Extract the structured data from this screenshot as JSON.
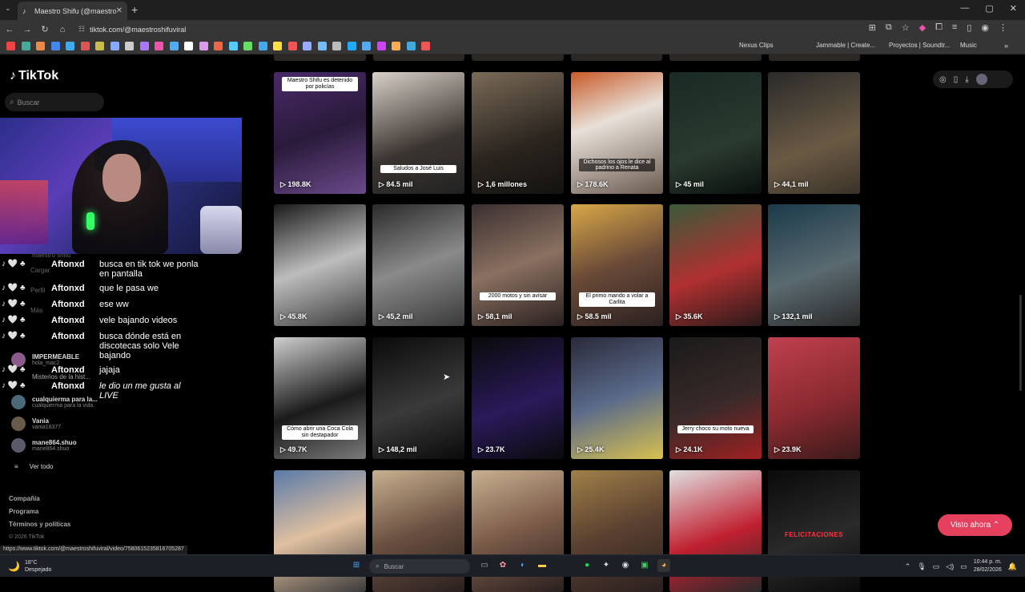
{
  "browser": {
    "tab_title": "Maestro Shifu (@maestroshifuvi...",
    "tab_close": "✕",
    "new_tab": "+",
    "url": "tiktok.com/@maestroshifuviral",
    "window_controls": [
      "—",
      "▢",
      "✕"
    ]
  },
  "bookmarks": {
    "nexus": "Nexus Clips",
    "jammable": "Jammable | Create...",
    "proyectos": "Proyectos | Soundtr...",
    "music": "Music",
    "colors": [
      "#e44",
      "#4a9",
      "#e84",
      "#48e",
      "#4ae",
      "#d55",
      "#cb4",
      "#8af",
      "#ccc",
      "#a7f",
      "#e5a",
      "#5ae",
      "#fff",
      "#d9e",
      "#e64",
      "#5cf",
      "#6d6",
      "#4ae",
      "#fd4",
      "#e55",
      "#9af",
      "#7bf",
      "#bbb",
      "#2af",
      "#5ae",
      "#c4f",
      "#fa5",
      "#4ad",
      "#e55"
    ]
  },
  "tiktok": {
    "logo": "TikTok",
    "search_placeholder": "Buscar",
    "accounts": [
      {
        "name": "IMPERMEABLE",
        "handle": "hola_mac2"
      },
      {
        "name": "cualquierma para la...",
        "handle": "cualquierma para la vida"
      },
      {
        "name": "Vania",
        "handle": "vania18377"
      },
      {
        "name": "mane864.shuo",
        "handle": "mane864.shuo"
      }
    ],
    "sidebar_bg": [
      "maestro shifu",
      "Cargar",
      "Perfil",
      "Más",
      "Misterios de la hist..."
    ],
    "see_all": "Ver todo",
    "footer": [
      "Compañía",
      "Programa",
      "Términos y políticas"
    ],
    "copyright": "© 2026 TikTok",
    "visto_ahora": "Visto ahora ⌃"
  },
  "chat": [
    {
      "user": "Aftonxd",
      "text": "busca en tik tok we ponla en pantalla",
      "italic": false
    },
    {
      "user": "Aftonxd",
      "text": "que le pasa we",
      "italic": false
    },
    {
      "user": "Aftonxd",
      "text": "ese ww",
      "italic": false
    },
    {
      "user": "Aftonxd",
      "text": "vele bajando videos",
      "italic": false
    },
    {
      "user": "Aftonxd",
      "text": "busca dónde está en discotecas solo Vele bajando",
      "italic": false
    },
    {
      "user": "Aftonxd",
      "text": "jajaja",
      "italic": false
    },
    {
      "user": "Aftonxd",
      "text": "le dio un me gusta al LIVE",
      "italic": true
    }
  ],
  "chat_badges": "♪ 🤍 ♣",
  "videos": [
    {
      "count": "198.8K",
      "caption": "Maestro Shifu es detenido por policías",
      "cap_pos": "top"
    },
    {
      "count": "84.5 mil",
      "caption": "Saludos a José Luis",
      "cap_pos": "mid"
    },
    {
      "count": "1,6 millones",
      "caption": "",
      "cap_pos": ""
    },
    {
      "count": "178.6K",
      "caption": "Dichosos los ojos le dice al padrino a Renata",
      "cap_pos": "mid-dark"
    },
    {
      "count": "45 mil",
      "caption": "",
      "cap_pos": ""
    },
    {
      "count": "44,1 mil",
      "caption": "",
      "cap_pos": ""
    },
    {
      "count": "45.8K",
      "caption": "",
      "cap_pos": ""
    },
    {
      "count": "45,2 mil",
      "caption": "",
      "cap_pos": ""
    },
    {
      "count": "58,1 mil",
      "caption": "2000 motos y sin avisar",
      "cap_pos": "bottom"
    },
    {
      "count": "58.5 mil",
      "caption": "El primo mando a volar a Carlita",
      "cap_pos": "bottom"
    },
    {
      "count": "35.6K",
      "caption": "",
      "cap_pos": ""
    },
    {
      "count": "132,1 mil",
      "caption": "",
      "cap_pos": ""
    },
    {
      "count": "49.7K",
      "caption": "Cómo abrir una Coca Cola sin destapador",
      "cap_pos": "bottom"
    },
    {
      "count": "148,2 mil",
      "caption": "",
      "cap_pos": ""
    },
    {
      "count": "23.7K",
      "caption": "",
      "cap_pos": ""
    },
    {
      "count": "25.4K",
      "caption": "",
      "cap_pos": ""
    },
    {
      "count": "24.1K",
      "caption": "Jerry choco su moto nueva",
      "cap_pos": "bottom"
    },
    {
      "count": "23.9K",
      "caption": "",
      "cap_pos": ""
    },
    {
      "count": "",
      "caption": "",
      "cap_pos": ""
    },
    {
      "count": "",
      "caption": "",
      "cap_pos": ""
    },
    {
      "count": "",
      "caption": "",
      "cap_pos": ""
    },
    {
      "count": "",
      "caption": "",
      "cap_pos": ""
    },
    {
      "count": "",
      "caption": "",
      "cap_pos": ""
    },
    {
      "count": "",
      "caption": "FELICITACIONES",
      "cap_pos": "fel"
    }
  ],
  "status_url": "https://www.tiktok.com/@maestroshifuviral/video/7580615235816705287",
  "taskbar": {
    "temp": "18°C",
    "weather": "Despejado",
    "search": "Buscar",
    "time": "10:44 p. m.",
    "date": "28/02/2026"
  }
}
